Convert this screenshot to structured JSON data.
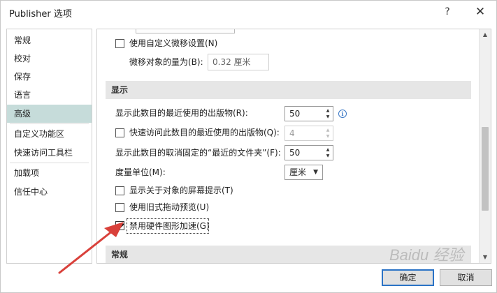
{
  "window": {
    "title": "Publisher 选项",
    "help_glyph": "?",
    "close_glyph": "✕"
  },
  "nav": {
    "items": [
      {
        "label": "常规"
      },
      {
        "label": "校对"
      },
      {
        "label": "保存"
      },
      {
        "label": "语言"
      },
      {
        "label": "高级",
        "selected": true
      },
      {
        "label": "自定义功能区"
      },
      {
        "label": "快速访问工具栏"
      },
      {
        "label": "加载项"
      },
      {
        "label": "信任中心"
      }
    ]
  },
  "content": {
    "custom_nudge": {
      "label": "使用自定义微移设置(N)",
      "checked": false
    },
    "nudge_amount": {
      "label": "微移对象的量为(B):",
      "value": "0.32 厘米"
    },
    "section_display": {
      "title": "显示"
    },
    "recent_publications": {
      "label": "显示此数目的最近使用的出版物(R):",
      "value": "50"
    },
    "quick_access_recent": {
      "label": "快速访问此数目的最近使用的出版物(Q):",
      "value": "4",
      "checked": false
    },
    "unpinned_recent_folders": {
      "label": "显示此数目的取消固定的“最近的文件夹”(F):",
      "value": "50"
    },
    "measurement_unit": {
      "label": "度量单位(M):",
      "value": "厘米"
    },
    "show_screentips": {
      "label": "显示关于对象的屏幕提示(T)",
      "checked": false
    },
    "legacy_drag_preview": {
      "label": "使用旧式拖动预览(U)",
      "checked": false
    },
    "disable_hw_accel": {
      "label": "禁用硬件图形加速(G)",
      "checked": true
    },
    "section_general": {
      "title": "常规"
    }
  },
  "footer": {
    "ok_label": "确定",
    "cancel_label": "取消"
  },
  "watermark": {
    "text": "Baidu 经验"
  },
  "colors": {
    "nav_selected": "#c6dcda",
    "section_header": "#e6e6e6",
    "annotation_arrow": "#d9413b",
    "default_button_border": "#2b73c6"
  },
  "icons": {
    "info": "info-icon",
    "spin_up": "chevron-up-icon",
    "spin_down": "chevron-down-icon",
    "dropdown": "dropdown-arrow-icon"
  }
}
